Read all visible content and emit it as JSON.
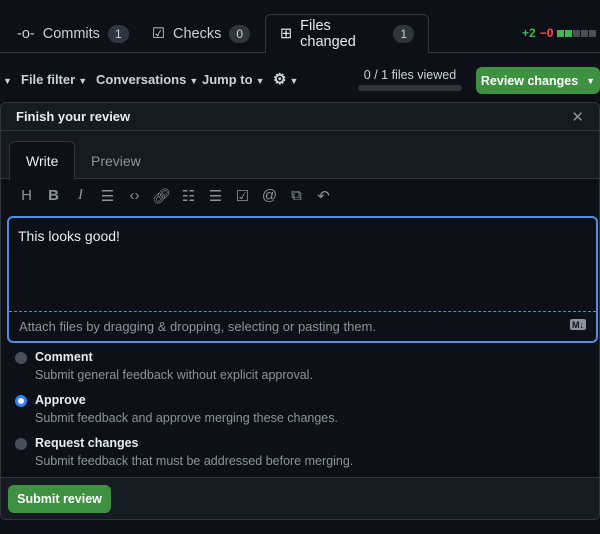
{
  "tabs": [
    {
      "label": "Commits",
      "count": "1",
      "icon": "commit-icon"
    },
    {
      "label": "Checks",
      "count": "0",
      "icon": "checklist-icon"
    },
    {
      "label": "Files changed",
      "count": "1",
      "icon": "file-diff-icon",
      "selected": true
    }
  ],
  "diffstat": {
    "additions": "+2",
    "deletions": "−0",
    "blocks": [
      "green",
      "green",
      "gray",
      "gray",
      "gray"
    ]
  },
  "toolbar": {
    "file_filter": "File filter",
    "conversations": "Conversations",
    "jump_to": "Jump to",
    "files_viewed": "0 / 1 files viewed",
    "files_viewed_fraction": 0,
    "review_changes": "Review changes"
  },
  "review": {
    "title": "Finish your review",
    "tab_write": "Write",
    "tab_preview": "Preview",
    "text": "This looks good!",
    "attach_hint": "Attach files by dragging & dropping, selecting or pasting them.",
    "options": [
      {
        "label": "Comment",
        "desc": "Submit general feedback without explicit approval.",
        "checked": false
      },
      {
        "label": "Approve",
        "desc": "Submit feedback and approve merging these changes.",
        "checked": true
      },
      {
        "label": "Request changes",
        "desc": "Submit feedback that must be addressed before merging.",
        "checked": false
      }
    ],
    "submit": "Submit review"
  },
  "colors": {
    "accent": "#2f81f7",
    "green": "#3f9142",
    "add": "#3fb950",
    "del": "#f85149"
  }
}
